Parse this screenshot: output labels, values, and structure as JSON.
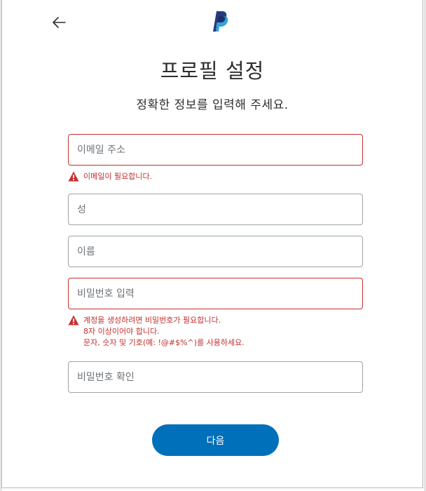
{
  "header": {
    "back_icon": "arrow-left-icon",
    "logo_icon": "paypal-logo-icon",
    "brand_colors": {
      "dark": "#253b80",
      "light": "#179bd7"
    }
  },
  "page": {
    "title": "프로필 설정",
    "subtitle": "정확한 정보를 입력해 주세요."
  },
  "form": {
    "email": {
      "placeholder": "이메일 주소",
      "value": "",
      "error": "이메일이 필요합니다."
    },
    "last_name": {
      "placeholder": "성",
      "value": ""
    },
    "first_name": {
      "placeholder": "이름",
      "value": ""
    },
    "password": {
      "placeholder": "비밀번호 입력",
      "value": "",
      "error_lines": [
        "계정을 생성하려면 비밀번호가 필요합니다.",
        "8자 이상이어야 합니다.",
        "문자, 숫자 및 기호(예: !@#$%^)를 사용하세요."
      ]
    },
    "confirm_password": {
      "placeholder": "비밀번호 확인",
      "value": ""
    },
    "next_label": "다음"
  },
  "colors": {
    "accent": "#0070ba",
    "error": "#c72e2e",
    "border": "#9da3a6",
    "text": "#2c2e2f"
  }
}
